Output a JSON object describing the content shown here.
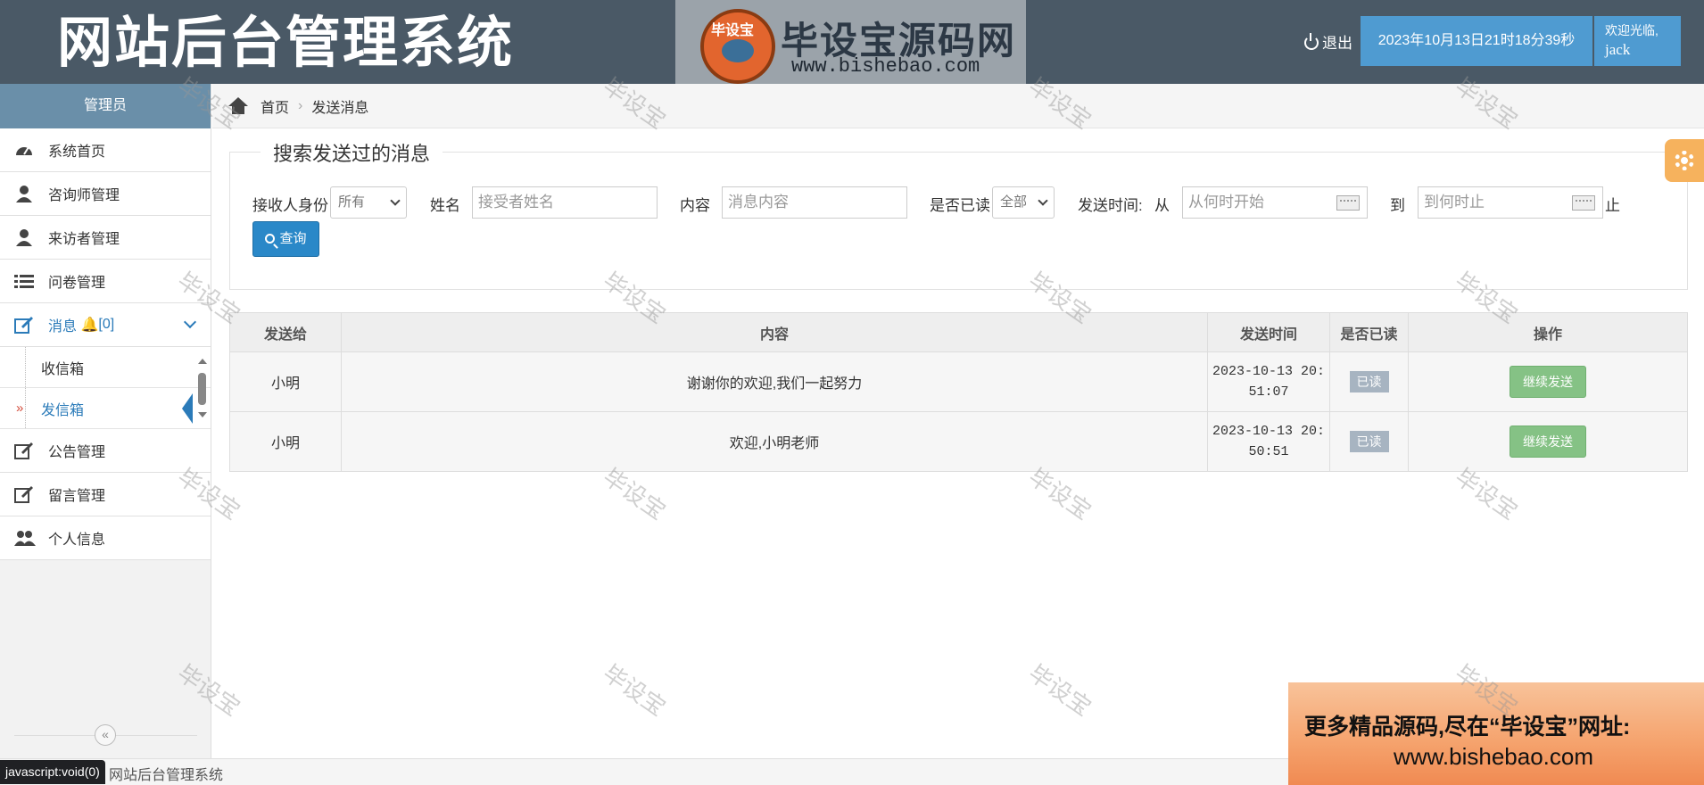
{
  "header": {
    "app_title": "网站后台管理系统",
    "brand_mark": "毕设宝",
    "brand_name": "毕设宝源码网",
    "brand_url": "www.bishebao.com",
    "logout_label": "退出",
    "datetime": "2023年10月13日21时18分39秒",
    "welcome": "欢迎光临,",
    "username": "jack"
  },
  "sidebar": {
    "role": "管理员",
    "items": [
      {
        "label": "系统首页",
        "icon": "dashboard-icon"
      },
      {
        "label": "咨询师管理",
        "icon": "user-icon"
      },
      {
        "label": "来访者管理",
        "icon": "user-icon"
      },
      {
        "label": "问卷管理",
        "icon": "list-icon"
      },
      {
        "label": "消息",
        "badge": "[0]",
        "icon": "edit-icon"
      },
      {
        "label": "公告管理",
        "icon": "edit-icon"
      },
      {
        "label": "留言管理",
        "icon": "edit-icon"
      },
      {
        "label": "个人信息",
        "icon": "users-icon"
      }
    ],
    "sub_items": [
      {
        "label": "收信箱"
      },
      {
        "label": "发信箱"
      }
    ],
    "collapse_glyph": "«"
  },
  "breadcrumb": {
    "home": "首页",
    "current": "发送消息",
    "separator": "›"
  },
  "search": {
    "title": "搜索发送过的消息",
    "receiver_role_label": "接收人身份",
    "receiver_role_value": "所有",
    "name_label": "姓名",
    "name_placeholder": "接受者姓名",
    "content_label": "内容",
    "content_placeholder": "消息内容",
    "read_label": "是否已读",
    "read_value": "全部",
    "time_label": "发送时间:",
    "from_label": "从",
    "from_placeholder": "从何时开始",
    "to_label": "到",
    "to_placeholder": "到何时止",
    "end_label": "止",
    "query_button": "查询"
  },
  "table": {
    "headers": [
      "发送给",
      "内容",
      "发送时间",
      "是否已读",
      "操作"
    ],
    "rows": [
      {
        "to": "小明",
        "content": "谢谢你的欢迎,我们一起努力",
        "time_line1": "2023-10-13 20:",
        "time_line2": "51:07",
        "read": "已读",
        "action": "继续发送"
      },
      {
        "to": "小明",
        "content": "欢迎,小明老师",
        "time_line1": "2023-10-13 20:",
        "time_line2": "50:51",
        "read": "已读",
        "action": "继续发送"
      }
    ]
  },
  "footer": {
    "text": "网站后台管理系统",
    "status_url": "javascript:void(0)"
  },
  "promo": {
    "line1": "更多精品源码,尽在“毕设宝”网址:",
    "line2": "www.bishebao.com"
  },
  "watermark": "毕设宝",
  "colors": {
    "header_bg": "#4a5966",
    "accent": "#4f9bd1",
    "sidebar_head": "#6a8fa9",
    "query_button": "#2a88c8",
    "resend_button": "#85c285",
    "read_badge": "#a7b4c1"
  }
}
